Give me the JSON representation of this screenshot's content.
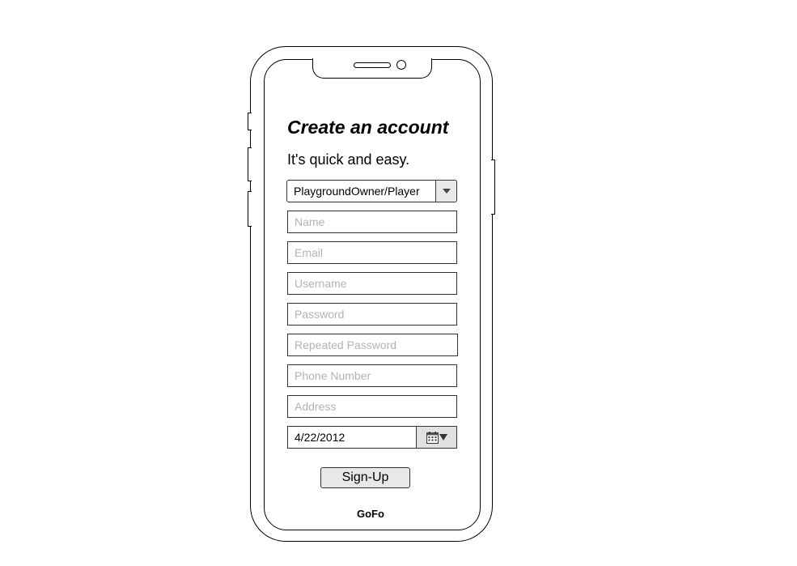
{
  "form": {
    "title": "Create an account",
    "subtitle": "It's quick and easy.",
    "account_type": {
      "selected": "PlaygroundOwner/Player",
      "icon": "chevron-down-icon"
    },
    "fields": {
      "name_placeholder": "Name",
      "email_placeholder": "Email",
      "username_placeholder": "Username",
      "password_placeholder": "Password",
      "repeated_password_placeholder": "Repeated Password",
      "phone_placeholder": "Phone Number",
      "address_placeholder": "Address"
    },
    "date": {
      "value": "4/22/2012",
      "icon": "calendar-icon"
    },
    "signup_label": "Sign-Up"
  },
  "footer": {
    "brand": "GoFo"
  }
}
